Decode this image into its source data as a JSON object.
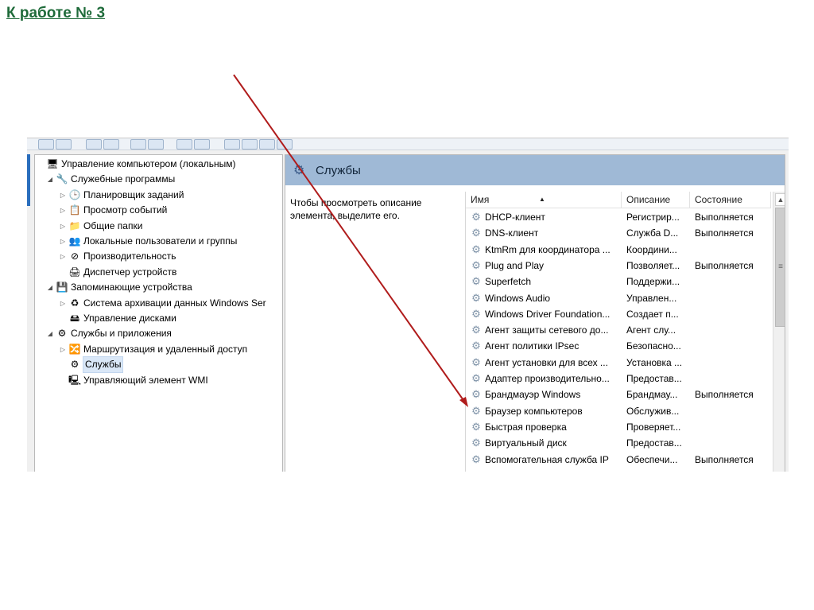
{
  "slide": {
    "title": "К работе № 3"
  },
  "tree": {
    "items": [
      {
        "label": "Управление компьютером (локальным)",
        "icon": "computer-management-icon",
        "glyph": "🖥",
        "arrow": ""
      },
      {
        "label": "Служебные программы",
        "icon": "tools-icon",
        "glyph": "🔧",
        "arrow": "◢"
      },
      {
        "label": "Планировщик заданий",
        "icon": "clock-icon",
        "glyph": "🕒",
        "arrow": "▷"
      },
      {
        "label": "Просмотр событий",
        "icon": "event-viewer-icon",
        "glyph": "📋",
        "arrow": "▷"
      },
      {
        "label": "Общие папки",
        "icon": "shared-folder-icon",
        "glyph": "📁",
        "arrow": "▷"
      },
      {
        "label": "Локальные пользователи и группы",
        "icon": "users-icon",
        "glyph": "👥",
        "arrow": "▷"
      },
      {
        "label": "Производительность",
        "icon": "performance-icon",
        "glyph": "⊘",
        "arrow": "▷"
      },
      {
        "label": "Диспетчер устройств",
        "icon": "device-manager-icon",
        "glyph": "🖨",
        "arrow": ""
      },
      {
        "label": "Запоминающие устройства",
        "icon": "storage-icon",
        "glyph": "💾",
        "arrow": "◢"
      },
      {
        "label": "Система архивации данных Windows Ser",
        "icon": "backup-icon",
        "glyph": "♻",
        "arrow": "▷"
      },
      {
        "label": "Управление дисками",
        "icon": "disk-management-icon",
        "glyph": "🖴",
        "arrow": ""
      },
      {
        "label": "Службы и приложения",
        "icon": "services-apps-icon",
        "glyph": "⚙",
        "arrow": "◢"
      },
      {
        "label": "Маршрутизация и удаленный доступ",
        "icon": "routing-icon",
        "glyph": "🔀",
        "arrow": "▷"
      },
      {
        "label": "Службы",
        "icon": "services-icon",
        "glyph": "⚙",
        "arrow": ""
      },
      {
        "label": "Управляющий элемент WMI",
        "icon": "wmi-icon",
        "glyph": "🖳",
        "arrow": ""
      }
    ]
  },
  "services": {
    "title": "Службы",
    "description_hint": "Чтобы просмотреть описание элемента, выделите его.",
    "columns": {
      "name": "Имя",
      "description": "Описание",
      "status": "Состояние"
    },
    "rows": [
      {
        "name": "DHCP-клиент",
        "description": "Регистрир...",
        "status": "Выполняется"
      },
      {
        "name": "DNS-клиент",
        "description": "Служба D...",
        "status": "Выполняется"
      },
      {
        "name": "KtmRm для координатора ...",
        "description": "Координи...",
        "status": ""
      },
      {
        "name": "Plug and Play",
        "description": "Позволяет...",
        "status": "Выполняется"
      },
      {
        "name": "Superfetch",
        "description": "Поддержи...",
        "status": ""
      },
      {
        "name": "Windows Audio",
        "description": "Управлен...",
        "status": ""
      },
      {
        "name": "Windows Driver Foundation...",
        "description": "Создает п...",
        "status": ""
      },
      {
        "name": "Агент защиты сетевого до...",
        "description": "Агент слу...",
        "status": ""
      },
      {
        "name": "Агент политики IPsec",
        "description": "Безопасно...",
        "status": ""
      },
      {
        "name": "Агент установки для всех ...",
        "description": "Установка ...",
        "status": ""
      },
      {
        "name": "Адаптер производительно...",
        "description": "Предостав...",
        "status": ""
      },
      {
        "name": "Брандмауэр Windows",
        "description": "Брандмау...",
        "status": "Выполняется"
      },
      {
        "name": "Браузер компьютеров",
        "description": "Обслужив...",
        "status": ""
      },
      {
        "name": "Быстрая проверка",
        "description": "Проверяет...",
        "status": ""
      },
      {
        "name": "Виртуальный диск",
        "description": "Предостав...",
        "status": ""
      },
      {
        "name": "Вспомогательная служба IP",
        "description": "Обеспечи...",
        "status": "Выполняется"
      }
    ]
  },
  "colors": {
    "title_green": "#1f6b3a",
    "annotation_arrow": "#b01c1c",
    "header_blue": "#9fb9d6"
  }
}
